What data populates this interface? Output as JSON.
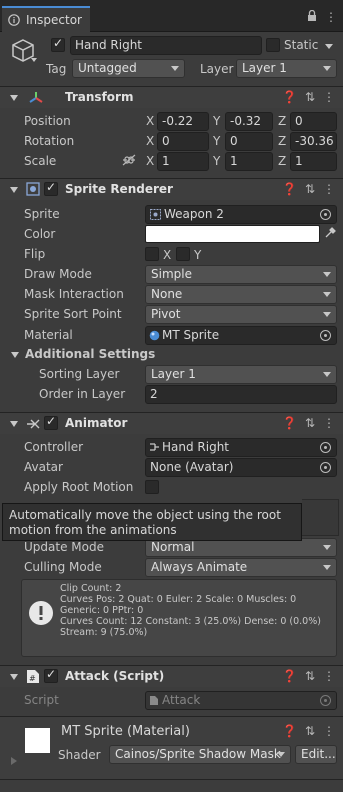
{
  "tab": {
    "label": "Inspector"
  },
  "gameobject": {
    "name": "Hand Right",
    "static_label": "Static",
    "tag_label": "Tag",
    "tag_value": "Untagged",
    "layer_label": "Layer",
    "layer_value": "Layer 1"
  },
  "transform": {
    "title": "Transform",
    "position_label": "Position",
    "rotation_label": "Rotation",
    "scale_label": "Scale",
    "position": {
      "x": "-0.22",
      "y": "-0.32",
      "z": "0"
    },
    "rotation": {
      "x": "0",
      "y": "0",
      "z": "-30.36"
    },
    "scale": {
      "x": "1",
      "y": "1",
      "z": "1"
    },
    "axis_x": "X",
    "axis_y": "Y",
    "axis_z": "Z"
  },
  "sprite_renderer": {
    "title": "Sprite Renderer",
    "sprite_label": "Sprite",
    "sprite_value": "Weapon 2",
    "color_label": "Color",
    "flip_label": "Flip",
    "flip_x": "X",
    "flip_y": "Y",
    "draw_mode_label": "Draw Mode",
    "draw_mode_value": "Simple",
    "mask_label": "Mask Interaction",
    "mask_value": "None",
    "sort_point_label": "Sprite Sort Point",
    "sort_point_value": "Pivot",
    "material_label": "Material",
    "material_value": "MT Sprite",
    "additional_label": "Additional Settings",
    "sorting_layer_label": "Sorting Layer",
    "sorting_layer_value": "Layer 1",
    "order_label": "Order in Layer",
    "order_value": "2"
  },
  "animator": {
    "title": "Animator",
    "controller_label": "Controller",
    "controller_value": "Hand Right",
    "avatar_label": "Avatar",
    "avatar_value": "None (Avatar)",
    "root_motion_label": "Apply Root Motion",
    "tooltip": "Automatically move the object using the root motion from the animations",
    "update_label": "Update Mode",
    "update_value": "Normal",
    "culling_label": "Culling Mode",
    "culling_value": "Always Animate",
    "info_lines": [
      "Clip Count: 2",
      "Curves Pos: 2 Quat: 0 Euler: 2 Scale: 0 Muscles: 0",
      "Generic: 0 PPtr: 0",
      "Curves Count: 12 Constant: 3 (25.0%) Dense: 0 (0.0%)",
      "Stream: 9 (75.0%)"
    ]
  },
  "attack": {
    "title": "Attack (Script)",
    "script_label": "Script",
    "script_value": "Attack"
  },
  "material": {
    "title": "MT Sprite (Material)",
    "shader_label": "Shader",
    "shader_value": "Cainos/Sprite Shadow Mask",
    "edit_label": "Edit..."
  },
  "colors": {
    "accent": "#4a8cd4",
    "panel": "#3c3c3c",
    "field": "#2a2a2a",
    "dropdown": "#515151"
  }
}
